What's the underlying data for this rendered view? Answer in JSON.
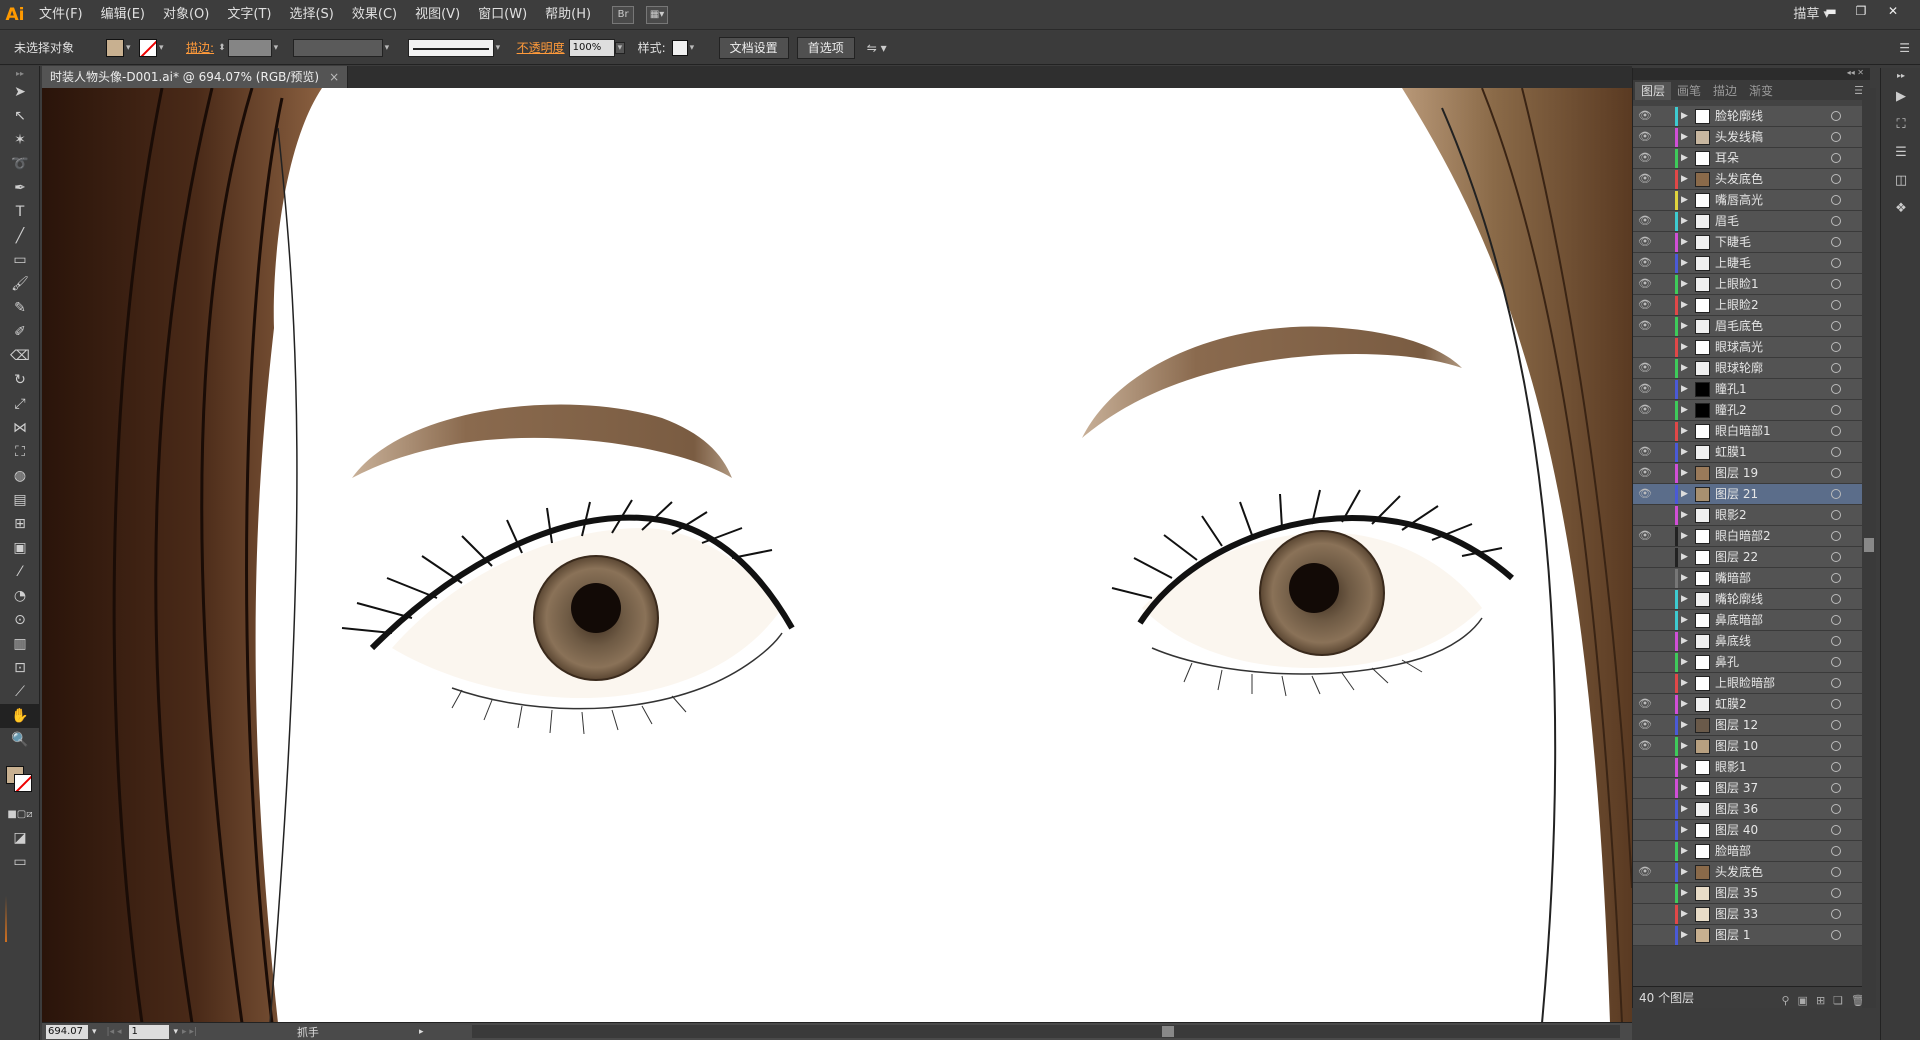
{
  "app": {
    "logo": "Ai"
  },
  "menu": [
    "文件(F)",
    "编辑(E)",
    "对象(O)",
    "文字(T)",
    "选择(S)",
    "效果(C)",
    "视图(V)",
    "窗口(W)",
    "帮助(H)"
  ],
  "workspace": "描草",
  "control": {
    "selection_label": "未选择对象",
    "stroke_label": "描边:",
    "opacity_label": "不透明度",
    "opacity_value": "100%",
    "style_label": "样式:",
    "doc_setup": "文档设置",
    "prefs": "首选项"
  },
  "document_tab": {
    "title": "时装人物头像-D001.ai* @ 694.07% (RGB/预览)",
    "close": "×"
  },
  "status": {
    "zoom": "694.07",
    "page": "1",
    "tool": "抓手"
  },
  "layers_panel": {
    "tabs": [
      "图层",
      "画笔",
      "描边",
      "渐变"
    ],
    "footer": "40 个图层",
    "layers": [
      {
        "name": "脸轮廓线",
        "color": "#3ecbd0",
        "eye": true,
        "thumb": "#ffffff"
      },
      {
        "name": "头发线稿",
        "color": "#d04fd6",
        "eye": true,
        "thumb": "#c8b7a0"
      },
      {
        "name": "耳朵",
        "color": "#3ecb5a",
        "eye": true,
        "thumb": "#ffffff"
      },
      {
        "name": "头发底色",
        "color": "#e04848",
        "eye": true,
        "thumb": "#8a6a4a"
      },
      {
        "name": "嘴唇高光",
        "color": "#e0d43e",
        "eye": false,
        "thumb": "#ffffff"
      },
      {
        "name": "眉毛",
        "color": "#3ecbd0",
        "eye": true,
        "thumb": "#f0f0f0"
      },
      {
        "name": "下睫毛",
        "color": "#d04fd6",
        "eye": true,
        "thumb": "#f0f0f0"
      },
      {
        "name": "上睫毛",
        "color": "#4a5ad6",
        "eye": true,
        "thumb": "#f0f0f0"
      },
      {
        "name": "上眼睑1",
        "color": "#3ecb5a",
        "eye": true,
        "thumb": "#f0f0f0"
      },
      {
        "name": "上眼睑2",
        "color": "#e04848",
        "eye": true,
        "thumb": "#ffffff"
      },
      {
        "name": "眉毛底色",
        "color": "#3ecb5a",
        "eye": true,
        "thumb": "#f0f0f0"
      },
      {
        "name": "眼球高光",
        "color": "#e04848",
        "eye": false,
        "thumb": "#ffffff"
      },
      {
        "name": "眼球轮廓",
        "color": "#3ecb5a",
        "eye": true,
        "thumb": "#f0f0f0"
      },
      {
        "name": "瞳孔1",
        "color": "#4a5ad6",
        "eye": true,
        "thumb": "#000000"
      },
      {
        "name": "瞳孔2",
        "color": "#3ecb5a",
        "eye": true,
        "thumb": "#000000"
      },
      {
        "name": "眼白暗部1",
        "color": "#e04848",
        "eye": false,
        "thumb": "#ffffff"
      },
      {
        "name": "虹膜1",
        "color": "#4a5ad6",
        "eye": true,
        "thumb": "#f0f0f0"
      },
      {
        "name": "图层 19",
        "color": "#d04fd6",
        "eye": true,
        "thumb": "#9a7a5a"
      },
      {
        "name": "图层 21",
        "color": "#4a5ad6",
        "eye": true,
        "thumb": "#a89070",
        "selected": true
      },
      {
        "name": "眼影2",
        "color": "#d04fd6",
        "eye": false,
        "thumb": "#f0f0f0"
      },
      {
        "name": "眼白暗部2",
        "color": "#222222",
        "eye": true,
        "thumb": "#ffffff"
      },
      {
        "name": "图层 22",
        "color": "#222222",
        "eye": false,
        "thumb": "#ffffff"
      },
      {
        "name": "嘴暗部",
        "color": "#777777",
        "eye": false,
        "thumb": "#ffffff"
      },
      {
        "name": "嘴轮廓线",
        "color": "#3ecbd0",
        "eye": false,
        "thumb": "#f0f0f0"
      },
      {
        "name": "鼻底暗部",
        "color": "#3ecbd0",
        "eye": false,
        "thumb": "#ffffff"
      },
      {
        "name": "鼻底线",
        "color": "#d04fd6",
        "eye": false,
        "thumb": "#f0f0f0"
      },
      {
        "name": "鼻孔",
        "color": "#3ecb5a",
        "eye": false,
        "thumb": "#ffffff"
      },
      {
        "name": "上眼睑暗部",
        "color": "#e04848",
        "eye": false,
        "thumb": "#ffffff"
      },
      {
        "name": "虹膜2",
        "color": "#d04fd6",
        "eye": true,
        "thumb": "#f0f0f0"
      },
      {
        "name": "图层 12",
        "color": "#4a5ad6",
        "eye": true,
        "thumb": "#6a5a4a"
      },
      {
        "name": "图层 10",
        "color": "#3ecb5a",
        "eye": true,
        "thumb": "#b8a080"
      },
      {
        "name": "眼影1",
        "color": "#d04fd6",
        "eye": false,
        "thumb": "#ffffff"
      },
      {
        "name": "图层 37",
        "color": "#d04fd6",
        "eye": false,
        "thumb": "#ffffff"
      },
      {
        "name": "图层 36",
        "color": "#4a5ad6",
        "eye": false,
        "thumb": "#f0f0f0"
      },
      {
        "name": "图层 40",
        "color": "#4a5ad6",
        "eye": false,
        "thumb": "#ffffff"
      },
      {
        "name": "脸暗部",
        "color": "#3ecb5a",
        "eye": false,
        "thumb": "#ffffff"
      },
      {
        "name": "头发底色",
        "color": "#4a5ad6",
        "eye": true,
        "thumb": "#8a6a4a"
      },
      {
        "name": "图层 35",
        "color": "#3ecb5a",
        "eye": false,
        "thumb": "#e8dcc8"
      },
      {
        "name": "图层 33",
        "color": "#e04848",
        "eye": false,
        "thumb": "#e8dcc8"
      },
      {
        "name": "图层 1",
        "color": "#4a5ad6",
        "eye": false,
        "thumb": "#c8b090"
      }
    ]
  }
}
